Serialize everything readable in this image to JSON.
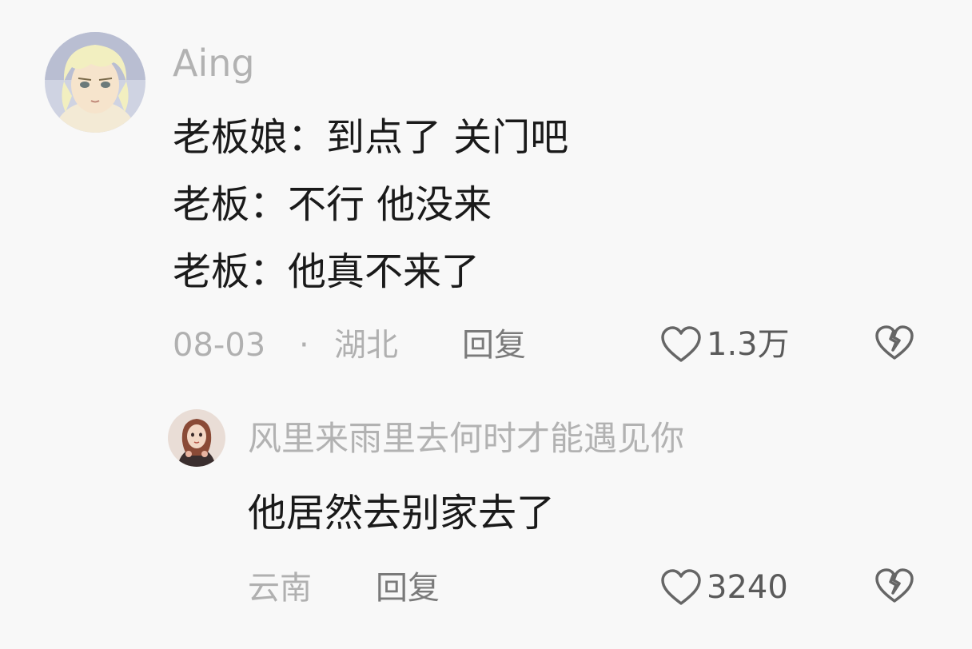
{
  "comments": [
    {
      "username": "Aing",
      "lines": [
        "老板娘：到点了 关门吧",
        "老板：不行 他没来",
        "老板：他真不来了"
      ],
      "date": "08-03",
      "location": "湖北",
      "reply_label": "回复",
      "likes": "1.3万",
      "avatar_icon": "anime-avatar-blonde-icon"
    },
    {
      "username": "风里来雨里去何时才能遇见你",
      "lines": [
        "他居然去别家去了"
      ],
      "location": "云南",
      "reply_label": "回复",
      "likes": "3240",
      "avatar_icon": "illustrated-avatar-woman-icon"
    }
  ],
  "colors": {
    "background": "#f8f8f8",
    "username": "#b2b2b2",
    "text": "#1a1a1a",
    "meta": "#b0b0b0",
    "action": "#7a7a7a"
  }
}
